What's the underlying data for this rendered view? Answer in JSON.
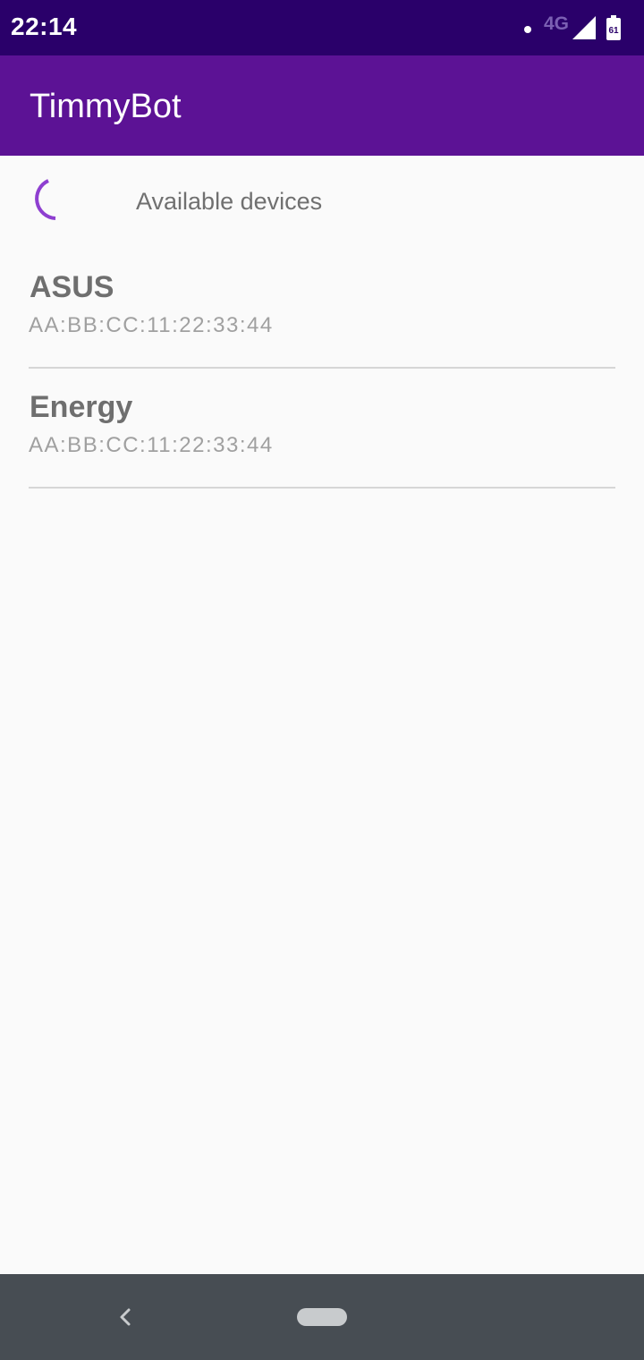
{
  "status_bar": {
    "time": "22:14",
    "network_type": "4G",
    "battery_level": "61",
    "icons": [
      "notification-dot",
      "signal-icon",
      "battery-icon"
    ]
  },
  "app_bar": {
    "title": "TimmyBot"
  },
  "list_header": {
    "label": "Available devices",
    "spinner_icon": "loading-spinner-icon"
  },
  "devices": [
    {
      "name": "ASUS",
      "address": "AA:BB:CC:11:22:33:44"
    },
    {
      "name": "Energy",
      "address": "AA:BB:CC:11:22:33:44"
    }
  ],
  "nav_bar": {
    "icons": [
      "back-icon",
      "home-pill"
    ]
  },
  "colors": {
    "status_bar": "#2a006a",
    "app_bar": "#5c1295",
    "spinner": "#8e3fd0",
    "background": "#fafafa",
    "nav_bar": "#474d53"
  }
}
